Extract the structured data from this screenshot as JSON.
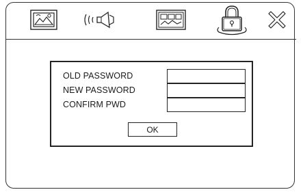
{
  "toolbar": {
    "icons": [
      "picture-settings-icon",
      "audio-settings-icon",
      "system-settings-icon",
      "password-lock-icon",
      "close-icon"
    ]
  },
  "dialog": {
    "old_password_label": "OLD PASSWORD",
    "new_password_label": "NEW PASSWORD",
    "confirm_label": "CONFIRM PWD",
    "old_password_value": "",
    "new_password_value": "",
    "confirm_value": "",
    "ok_label": "OK"
  }
}
